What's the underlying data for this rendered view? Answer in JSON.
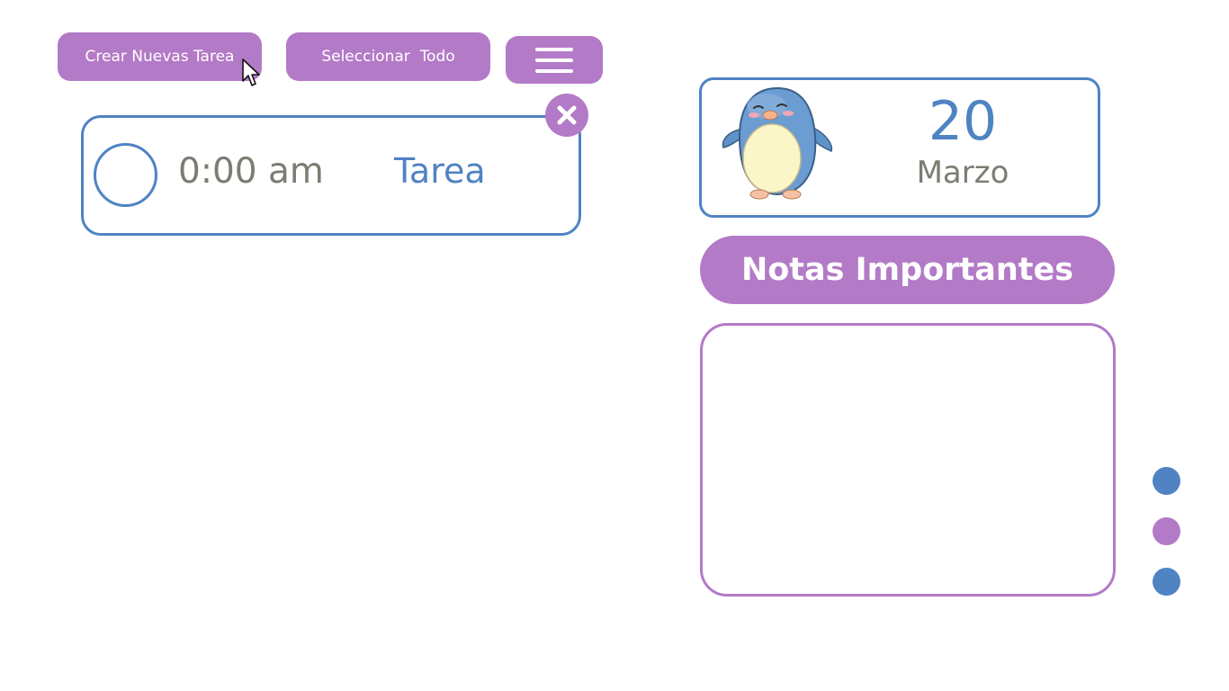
{
  "toolbar": {
    "create_label": "Crear Nuevas Tarea",
    "select_all_label": "Seleccionar  Todo",
    "menu_icon": "hamburger-menu-icon"
  },
  "task": {
    "time": "0:00 am",
    "name": "Tarea",
    "checkbox_state": "unchecked",
    "delete_icon": "close-icon"
  },
  "date_card": {
    "day": "20",
    "month": "Marzo",
    "mascot": "penguin-illustration"
  },
  "notes": {
    "title": "Notas Importantes",
    "content": ""
  },
  "pagination": {
    "dots": [
      "blue",
      "purple",
      "blue"
    ]
  },
  "colors": {
    "purple_accent": "#b37ac7",
    "blue_accent": "#4f83c3",
    "gray_text": "#7d7b72"
  }
}
